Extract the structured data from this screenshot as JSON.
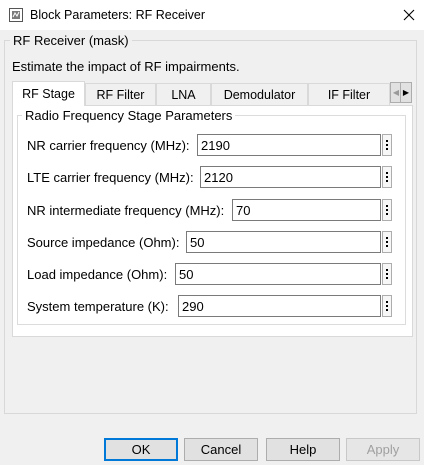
{
  "window": {
    "title": "Block Parameters: RF Receiver",
    "close_glyph": "✕"
  },
  "mask": {
    "group_label": "RF Receiver (mask)",
    "description": "Estimate the impact of RF impairments."
  },
  "tabs": [
    {
      "label": "RF Stage",
      "active": true
    },
    {
      "label": "RF Filter",
      "active": false
    },
    {
      "label": "LNA",
      "active": false
    },
    {
      "label": "Demodulator",
      "active": false
    },
    {
      "label": "IF Filter",
      "active": false
    }
  ],
  "tab_scroll": {
    "left_glyph": "◀",
    "right_glyph": "▶"
  },
  "section": {
    "title": "Radio Frequency Stage Parameters",
    "params": [
      {
        "label": "NR carrier frequency (MHz):",
        "value": "2190"
      },
      {
        "label": "LTE carrier frequency (MHz):",
        "value": "2120"
      },
      {
        "label": "NR intermediate frequency (MHz):",
        "value": "70"
      },
      {
        "label": "Source impedance (Ohm):",
        "value": "50"
      },
      {
        "label": "Load impedance (Ohm):",
        "value": "50"
      },
      {
        "label": "System temperature (K):",
        "value": "290"
      }
    ]
  },
  "buttons": {
    "ok": "OK",
    "cancel": "Cancel",
    "help": "Help",
    "apply": "Apply"
  },
  "icons": {
    "app": "simulink-block-icon",
    "close": "close-icon",
    "param_menu": "kebab-menu-icon"
  },
  "colors": {
    "accent": "#0078d7",
    "window_bg": "#f0f0f0"
  }
}
